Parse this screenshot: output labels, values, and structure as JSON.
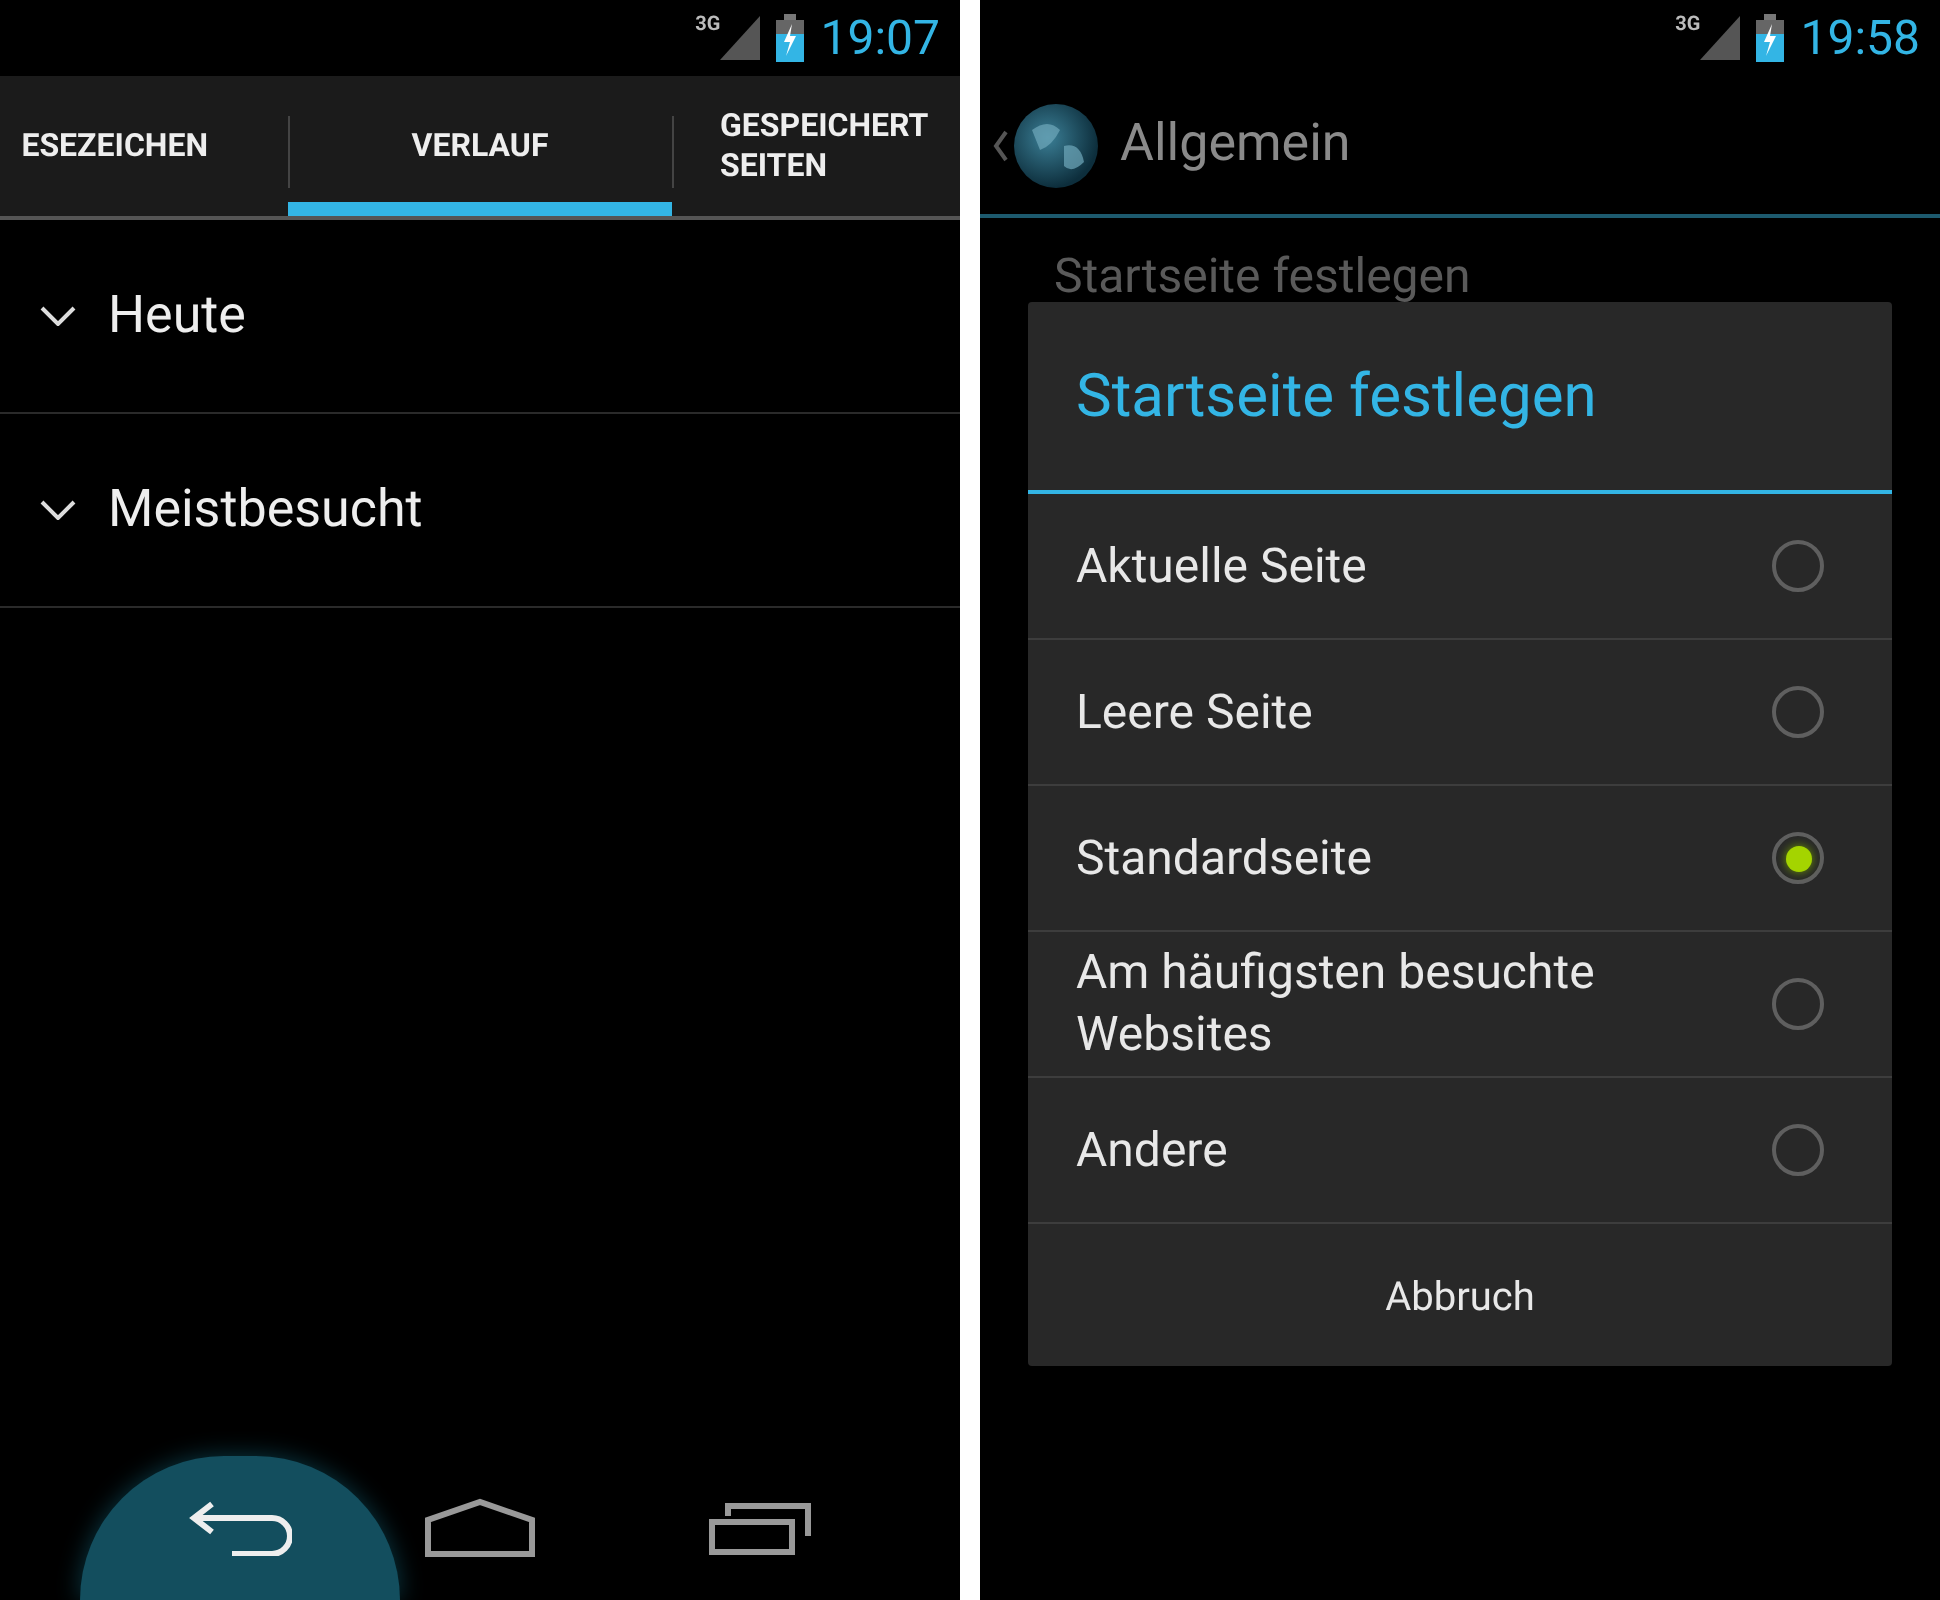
{
  "left_screen": {
    "status_bar": {
      "network": "3G",
      "time": "19:07"
    },
    "tabs": [
      {
        "label": "ESEZEICHEN",
        "selected": false
      },
      {
        "label": "VERLAUF",
        "selected": true
      },
      {
        "label": "GESPEICHERT\nSEITEN",
        "selected": false
      }
    ],
    "groups": [
      {
        "label": "Heute"
      },
      {
        "label": "Meistbesucht"
      }
    ],
    "nav_bar": [
      {
        "kind": "back",
        "pressed": true
      },
      {
        "kind": "home",
        "pressed": false
      },
      {
        "kind": "recents",
        "pressed": false
      }
    ]
  },
  "right_screen": {
    "status_bar": {
      "network": "3G",
      "time": "19:58"
    },
    "action_bar": {
      "title": "Allgemein"
    },
    "setting_behind": "Startseite festlegen",
    "dialog": {
      "title": "Startseite festlegen",
      "options": [
        {
          "label": "Aktuelle Seite",
          "selected": false
        },
        {
          "label": "Leere Seite",
          "selected": false
        },
        {
          "label": "Standardseite",
          "selected": true
        },
        {
          "label": "Am häufigsten besuchte Websites",
          "selected": false
        },
        {
          "label": "Andere",
          "selected": false
        }
      ],
      "button": "Abbruch"
    }
  }
}
